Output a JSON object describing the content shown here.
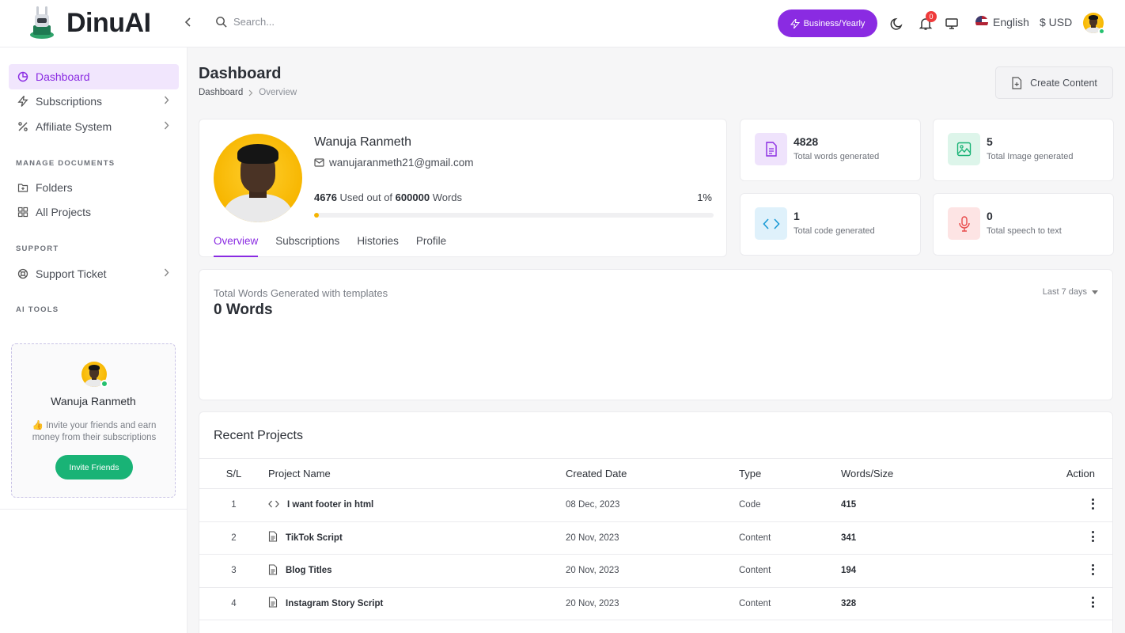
{
  "app": {
    "name": "DinuAI"
  },
  "topbar": {
    "search_placeholder": "Search...",
    "plan_label": "Business/Yearly",
    "notifications_count": "0",
    "language": "English",
    "currency": "$ USD"
  },
  "sidebar": {
    "items": [
      {
        "label": "Dashboard",
        "icon": "pie-chart-icon",
        "active": true
      },
      {
        "label": "Subscriptions",
        "icon": "bolt-icon"
      },
      {
        "label": "Affiliate System",
        "icon": "percent-icon"
      }
    ],
    "sections": [
      {
        "label": "MANAGE DOCUMENTS",
        "items": [
          {
            "label": "Folders",
            "icon": "folder-plus-icon"
          },
          {
            "label": "All Projects",
            "icon": "grid-icon"
          }
        ]
      },
      {
        "label": "SUPPORT",
        "items": [
          {
            "label": "Support Ticket",
            "icon": "lifebuoy-icon"
          }
        ]
      },
      {
        "label": "AI TOOLS",
        "items": []
      }
    ],
    "invite_card": {
      "name": "Wanuja Ranmeth",
      "description": "👍 Invite your friends and earn money from their subscriptions",
      "button_label": "Invite Friends"
    }
  },
  "header": {
    "title": "Dashboard",
    "breadcrumb": [
      "Dashboard",
      "Overview"
    ],
    "create_button": "Create Content"
  },
  "profile": {
    "name": "Wanuja Ranmeth",
    "email": "wanujaranmeth21@gmail.com",
    "used_words": "4676",
    "used_text_mid": "Used out of",
    "total_words": "600000",
    "used_text_end": "Words",
    "percent_label": "1%",
    "usage_fraction": 0.01,
    "tabs": [
      "Overview",
      "Subscriptions",
      "Histories",
      "Profile"
    ]
  },
  "stats": [
    {
      "value": "4828",
      "label": "Total words generated",
      "icon": "document-icon",
      "bg": "#efe3fc",
      "color": "#8a2be2"
    },
    {
      "value": "5",
      "label": "Total Image generated",
      "icon": "image-icon",
      "bg": "#ddf5ea",
      "color": "#19b376"
    },
    {
      "value": "1",
      "label": "Total code generated",
      "icon": "code-icon",
      "bg": "#dff1fb",
      "color": "#1a9ad6"
    },
    {
      "value": "0",
      "label": "Total speech to text",
      "icon": "microphone-icon",
      "bg": "#fde4e4",
      "color": "#e84a4a"
    }
  ],
  "words_chart": {
    "label": "Total Words Generated with templates",
    "value": "0 Words",
    "range": "Last 7 days"
  },
  "projects": {
    "title": "Recent Projects",
    "columns": [
      "S/L",
      "Project Name",
      "Created Date",
      "Type",
      "Words/Size",
      "Action"
    ],
    "rows": [
      {
        "sl": "1",
        "name": "I want footer in html",
        "date": "08 Dec, 2023",
        "type": "Code",
        "words": "415",
        "icon": "code-icon"
      },
      {
        "sl": "2",
        "name": "TikTok Script",
        "date": "20 Nov, 2023",
        "type": "Content",
        "words": "341",
        "icon": "document-icon"
      },
      {
        "sl": "3",
        "name": "Blog Titles",
        "date": "20 Nov, 2023",
        "type": "Content",
        "words": "194",
        "icon": "document-icon"
      },
      {
        "sl": "4",
        "name": "Instagram Story Script",
        "date": "20 Nov, 2023",
        "type": "Content",
        "words": "328",
        "icon": "document-icon"
      }
    ]
  },
  "colors": {
    "accent": "#8a2be2",
    "success": "#19b376",
    "progress": "#f5b400"
  }
}
